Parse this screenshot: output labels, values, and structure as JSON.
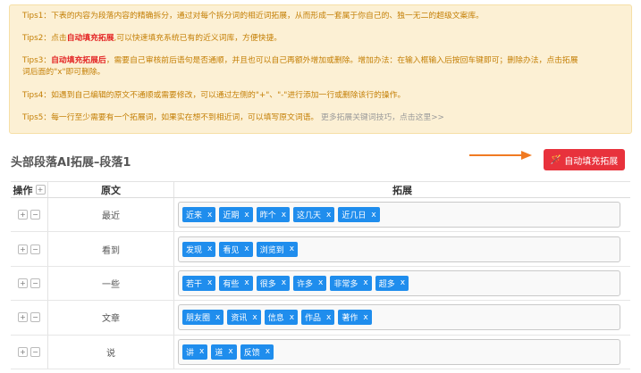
{
  "tips": {
    "tip1": "Tips1：下表的内容为段落内容的精确拆分，通过对每个拆分词的相近词拓展，从而形成一套属于你自己的、独一无二的超级文案库。",
    "tip2_prefix": "Tips2：点击",
    "tip2_red": "自动填充拓展",
    "tip2_suffix": ",可以快速填充系统已有的近义词库，方便快捷。",
    "tip3_prefix": "Tips3：",
    "tip3_red": "自动填充拓展后",
    "tip3_line1": "，需要自己审核前后语句是否通顺，并且也可以自己再额外增加或删除。增加办法：在输入框输入后按回车键即可；删除办法，点击拓展",
    "tip3_line2": "词后面的\"x\"即可删除。",
    "tip4": "Tips4：如遇到自己编辑的原文不通顺或需要修改，可以通过左侧的\"+\"、\"-\"进行添加一行或删除该行的操作。",
    "tip5_prefix": "Tips5：每一行至少需要有一个拓展词，如果实在想不到相近词，可以填写原文词语。",
    "tip5_gray": "更多拓展关键词技巧，",
    "tip5_link": "点击这里>>"
  },
  "section": {
    "title": "头部段落AI拓展–段落1"
  },
  "auto_button": {
    "label": "自动填充拓展"
  },
  "table": {
    "header_op": "操作",
    "header_src": "原文",
    "header_exp": "拓展",
    "plus": "+",
    "minus": "−",
    "tag_close": "x",
    "rows": [
      {
        "src": "最近",
        "tags": [
          "近来",
          "近期",
          "昨个",
          "这几天",
          "近几日"
        ]
      },
      {
        "src": "看到",
        "tags": [
          "发现",
          "看见",
          "浏览到"
        ]
      },
      {
        "src": "一些",
        "tags": [
          "若干",
          "有些",
          "很多",
          "许多",
          "非常多",
          "超多"
        ]
      },
      {
        "src": "文章",
        "tags": [
          "朋友圈",
          "资讯",
          "信息",
          "作品",
          "著作"
        ]
      },
      {
        "src": "说",
        "tags": [
          "讲",
          "道",
          "反馈"
        ]
      }
    ]
  },
  "colors": {
    "tip_text": "#c47f06",
    "tip_red": "#e32323",
    "tag": "#1f8ded",
    "button": "#e8323c",
    "arrow": "#f07a22"
  }
}
